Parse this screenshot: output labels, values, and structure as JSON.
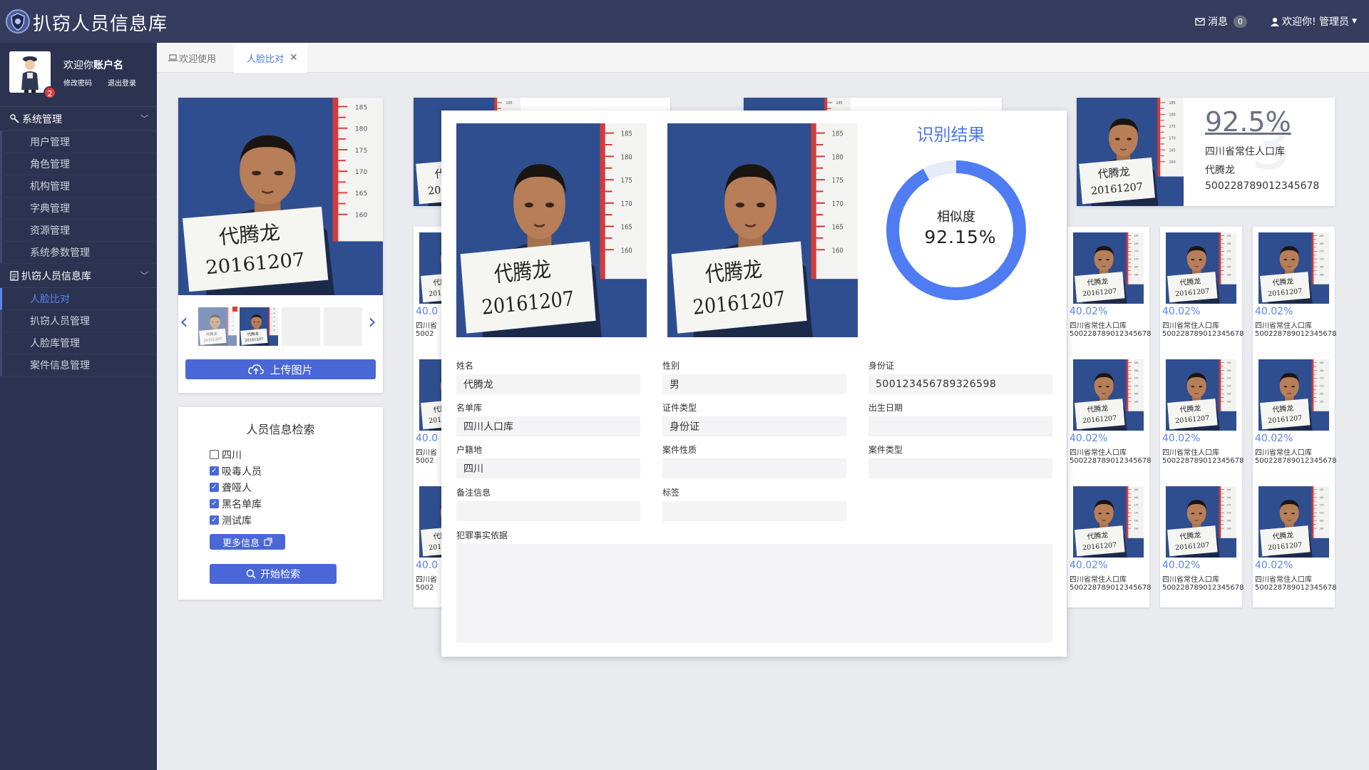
{
  "header": {
    "title": "扒窃人员信息库",
    "messages_label": "消息",
    "messages_count": "0",
    "user_label": "欢迎你! 管理员"
  },
  "profile": {
    "welcome_prefix": "欢迎你",
    "account": "账户名",
    "change_password": "修改密码",
    "logout": "退出登录",
    "notif_count": "2"
  },
  "sidebar": {
    "groups": [
      {
        "label": "系统管理",
        "items": [
          "用户管理",
          "角色管理",
          "机构管理",
          "字典管理",
          "资源管理",
          "系统参数管理"
        ]
      },
      {
        "label": "扒窃人员信息库",
        "items": [
          "人脸比对",
          "扒窃人员管理",
          "人脸库管理",
          "案件信息管理"
        ]
      }
    ],
    "active": "人脸比对"
  },
  "tabs": {
    "welcome": "欢迎使用",
    "face_compare": "人脸比对"
  },
  "upload": {
    "button": "上传图片"
  },
  "search": {
    "title": "人员信息检索",
    "options": [
      "四川",
      "吸毒人员",
      "聋哑人",
      "黑名单库",
      "测试库"
    ],
    "checked": [
      false,
      true,
      true,
      true,
      true
    ],
    "more": "更多信息",
    "start": "开始检索"
  },
  "photo": {
    "name": "代腾龙",
    "number": "20161207",
    "date": "2016/12/7"
  },
  "top_match": {
    "score": "92.5%",
    "rank": "3",
    "library": "四川省常住人口库",
    "name": "代腾龙",
    "id": "500228789012345678"
  },
  "matches": {
    "percent": "40.02%",
    "percent_short": "40.0",
    "library": "四川省常住人口库",
    "library_short": "四川省",
    "id": "500228789012345678",
    "id_short": "5002"
  },
  "result": {
    "title": "识别结果",
    "similarity_label": "相似度",
    "similarity_value": "92.15%",
    "similarity": 0.9215,
    "fields": {
      "name": {
        "label": "姓名",
        "value": "代腾龙"
      },
      "gender": {
        "label": "性别",
        "value": "男"
      },
      "id_card": {
        "label": "身份证",
        "value": "500123456789326598"
      },
      "list": {
        "label": "名单库",
        "value": "四川人口库"
      },
      "cert_type": {
        "label": "证件类型",
        "value": "身份证"
      },
      "birth": {
        "label": "出生日期",
        "value": ""
      },
      "household": {
        "label": "户籍地",
        "value": "四川"
      },
      "case_nature": {
        "label": "案件性质",
        "value": ""
      },
      "case_type": {
        "label": "案件类型",
        "value": ""
      },
      "remark": {
        "label": "备注信息",
        "value": ""
      },
      "tag": {
        "label": "标签",
        "value": ""
      },
      "evidence": {
        "label": "犯罪事实依据",
        "value": ""
      }
    }
  },
  "colors": {
    "header": "#353c5e",
    "sidebar": "#2b3350",
    "accent": "#4a67d8",
    "ring": "#4f7cf2"
  }
}
